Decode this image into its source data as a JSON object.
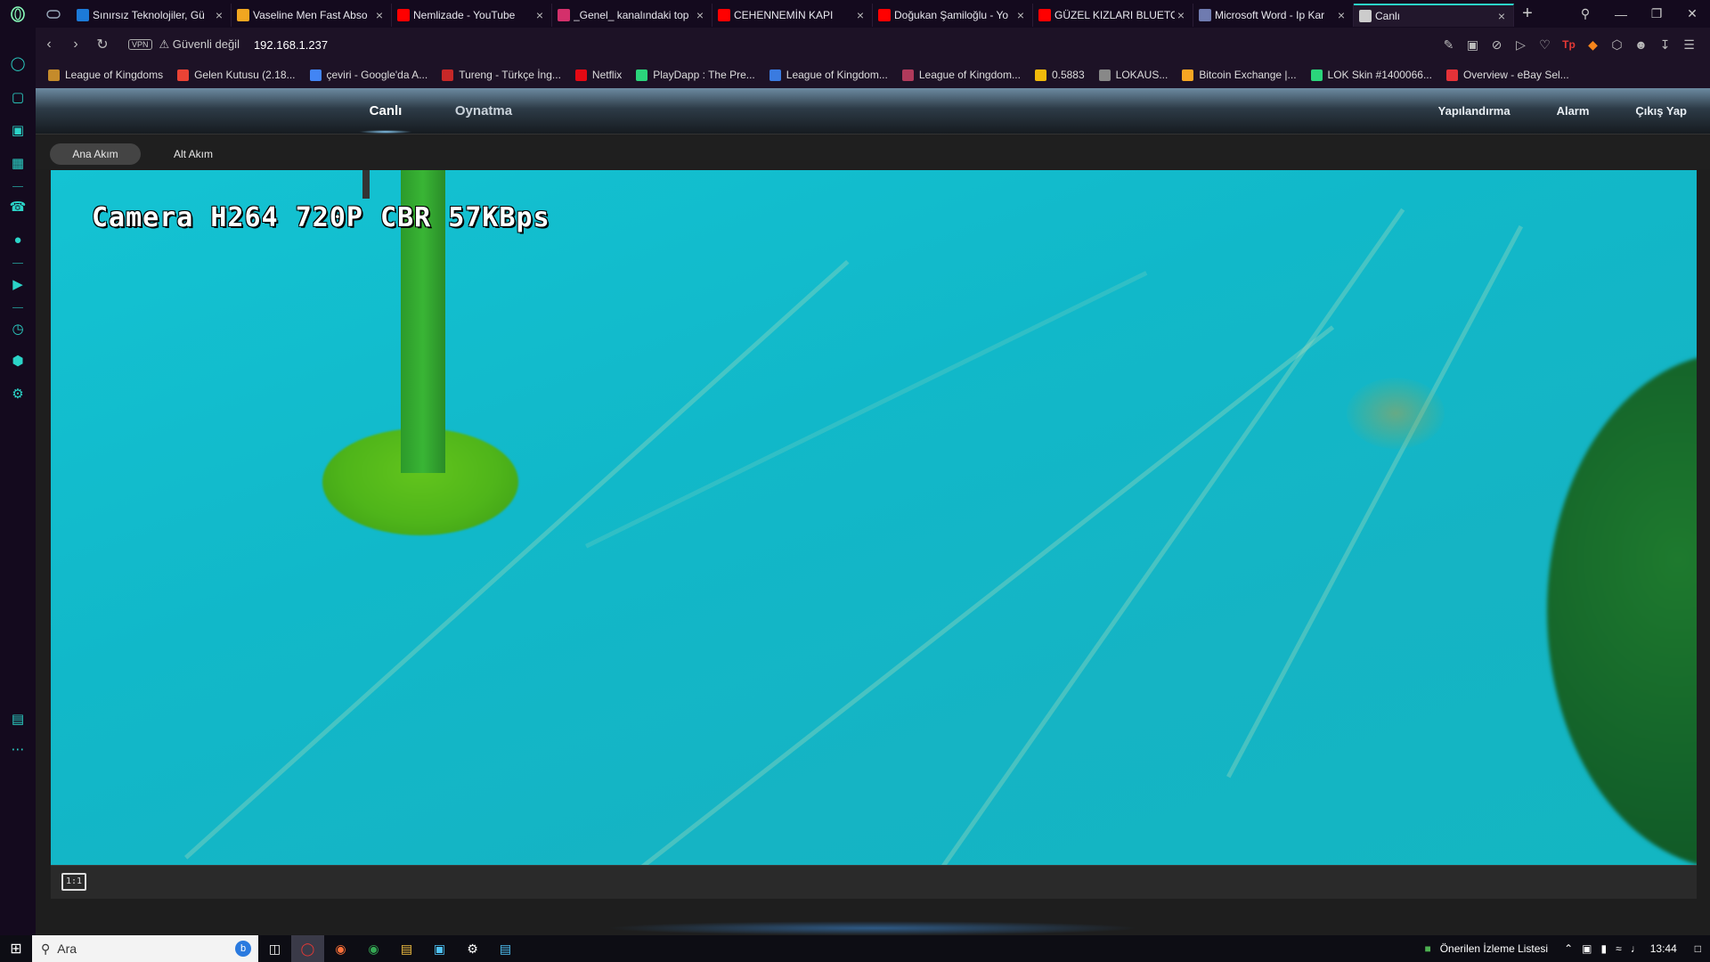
{
  "browser": {
    "tabs": [
      {
        "label": "Sınırsız Teknolojiler, Gü",
        "color": "#1c7ad8",
        "active": false
      },
      {
        "label": "Vaseline Men Fast Abso",
        "color": "#f1a620",
        "active": false
      },
      {
        "label": "Nemlizade - YouTube",
        "color": "#ff0000",
        "active": false
      },
      {
        "label": "_Genel_ kanalındaki top",
        "color": "#d4306b",
        "active": false
      },
      {
        "label": "CEHENNEMİN KAPI",
        "color": "#ff0000",
        "active": false
      },
      {
        "label": "Doğukan Şamiloğlu - Yo",
        "color": "#ff0000",
        "active": false
      },
      {
        "label": "GÜZEL KIZLARI BLUETO",
        "color": "#ff0000",
        "active": false
      },
      {
        "label": "Microsoft Word - Ip Kar",
        "color": "#6f7bb0",
        "active": false
      },
      {
        "label": "Canlı",
        "color": "#cccccc",
        "active": true
      }
    ],
    "security_label": "Güvenli değil",
    "vpn_label": "VPN",
    "url": "192.168.1.237",
    "bookmarks": [
      {
        "label": "League of Kingdoms",
        "color": "#c58b2b"
      },
      {
        "label": "Gelen Kutusu (2.18...",
        "color": "#ea4335"
      },
      {
        "label": "çeviri - Google'da A...",
        "color": "#4285f4"
      },
      {
        "label": "Tureng - Türkçe İng...",
        "color": "#c62828"
      },
      {
        "label": "Netflix",
        "color": "#e50914"
      },
      {
        "label": "PlayDapp : The Pre...",
        "color": "#2bd47b"
      },
      {
        "label": "League of Kingdom...",
        "color": "#3a7be0"
      },
      {
        "label": "League of Kingdom...",
        "color": "#b03a5b"
      },
      {
        "label": "0.5883",
        "color": "#f0b90b"
      },
      {
        "label": "LOKAUS...",
        "color": "#888888"
      },
      {
        "label": "Bitcoin Exchange |...",
        "color": "#f5a623"
      },
      {
        "label": "LOK Skin #1400066...",
        "color": "#2bd47b"
      },
      {
        "label": "Overview - eBay Sel...",
        "color": "#e53238"
      }
    ]
  },
  "camera": {
    "nav_left": [
      "Canlı",
      "Oynatma"
    ],
    "nav_right": [
      "Yapılandırma",
      "Alarm",
      "Çıkış Yap"
    ],
    "streams": {
      "main": "Ana Akım",
      "sub": "Alt Akım"
    },
    "overlay_text": "Camera H264 720P CBR 57KBps",
    "fullscreen_label": "1:1"
  },
  "taskbar": {
    "search_placeholder": "Ara",
    "bing_label": "b",
    "watchlist_label": "Önerilen İzleme Listesi",
    "clock": "13:44"
  },
  "colors": {
    "accent": "#2bd4c8",
    "browser_bg": "#140a1e",
    "video_bg": "#14bccb"
  }
}
